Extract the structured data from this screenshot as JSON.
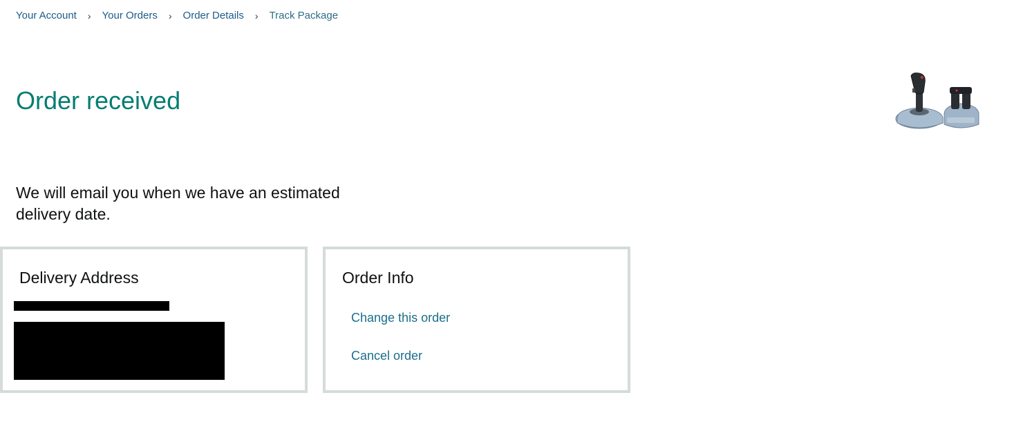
{
  "breadcrumb": {
    "items": [
      "Your Account",
      "Your Orders",
      "Order Details",
      "Track Package"
    ],
    "separator": "›"
  },
  "title": "Order received",
  "message": "We will email you when we have an estimated delivery date.",
  "product": {
    "icon": "flight-joystick-throttle-image"
  },
  "delivery_address": {
    "heading": "Delivery Address"
  },
  "order_info": {
    "heading": "Order Info",
    "change_label": "Change this order",
    "cancel_label": "Cancel order"
  },
  "colors": {
    "title": "#067d72",
    "link": "#1a6e8a",
    "border": "#d5dbdb",
    "breadcrumb": "#1a5c8a"
  }
}
